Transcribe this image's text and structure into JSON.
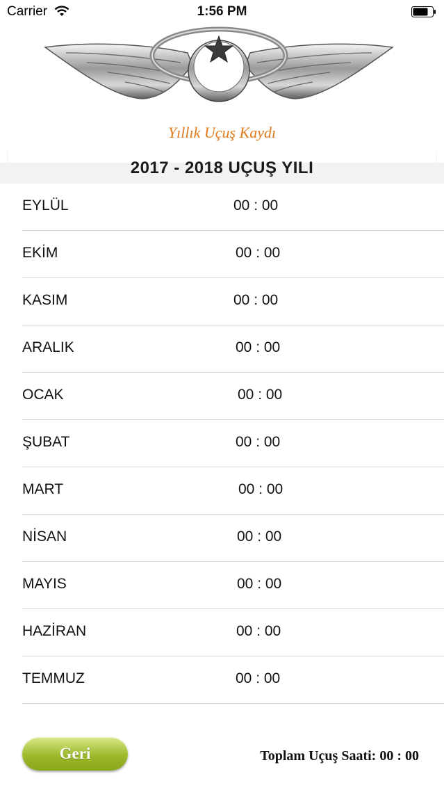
{
  "status_bar": {
    "carrier": "Carrier",
    "time": "1:56 PM"
  },
  "header": {
    "subtitle": "Yıllık Uçuş Kaydı",
    "year_title": "2017 -  2018 UÇUŞ YILI"
  },
  "months": [
    {
      "name": "EYLÜL",
      "hours": "00 : 00"
    },
    {
      "name": "EKİM",
      "hours": "00 : 00"
    },
    {
      "name": "KASIM",
      "hours": "00 : 00"
    },
    {
      "name": "ARALIK",
      "hours": "00 : 00"
    },
    {
      "name": "OCAK",
      "hours": "00 : 00"
    },
    {
      "name": "ŞUBAT",
      "hours": "00 : 00"
    },
    {
      "name": "MART",
      "hours": "00 : 00"
    },
    {
      "name": "NİSAN",
      "hours": "00 : 00"
    },
    {
      "name": "MAYIS",
      "hours": "00 : 00"
    },
    {
      "name": "HAZİRAN",
      "hours": "00 : 00"
    },
    {
      "name": "TEMMUZ",
      "hours": "00 : 00"
    }
  ],
  "footer": {
    "back_label": "Geri",
    "total_label": "Toplam Uçuş Saati:",
    "total_value": "00 : 00"
  },
  "colors": {
    "subtitle": "#e07b1c",
    "button": "#9cba2a"
  },
  "icons": [
    "wifi-icon",
    "battery-icon",
    "pilot-wings-logo"
  ]
}
